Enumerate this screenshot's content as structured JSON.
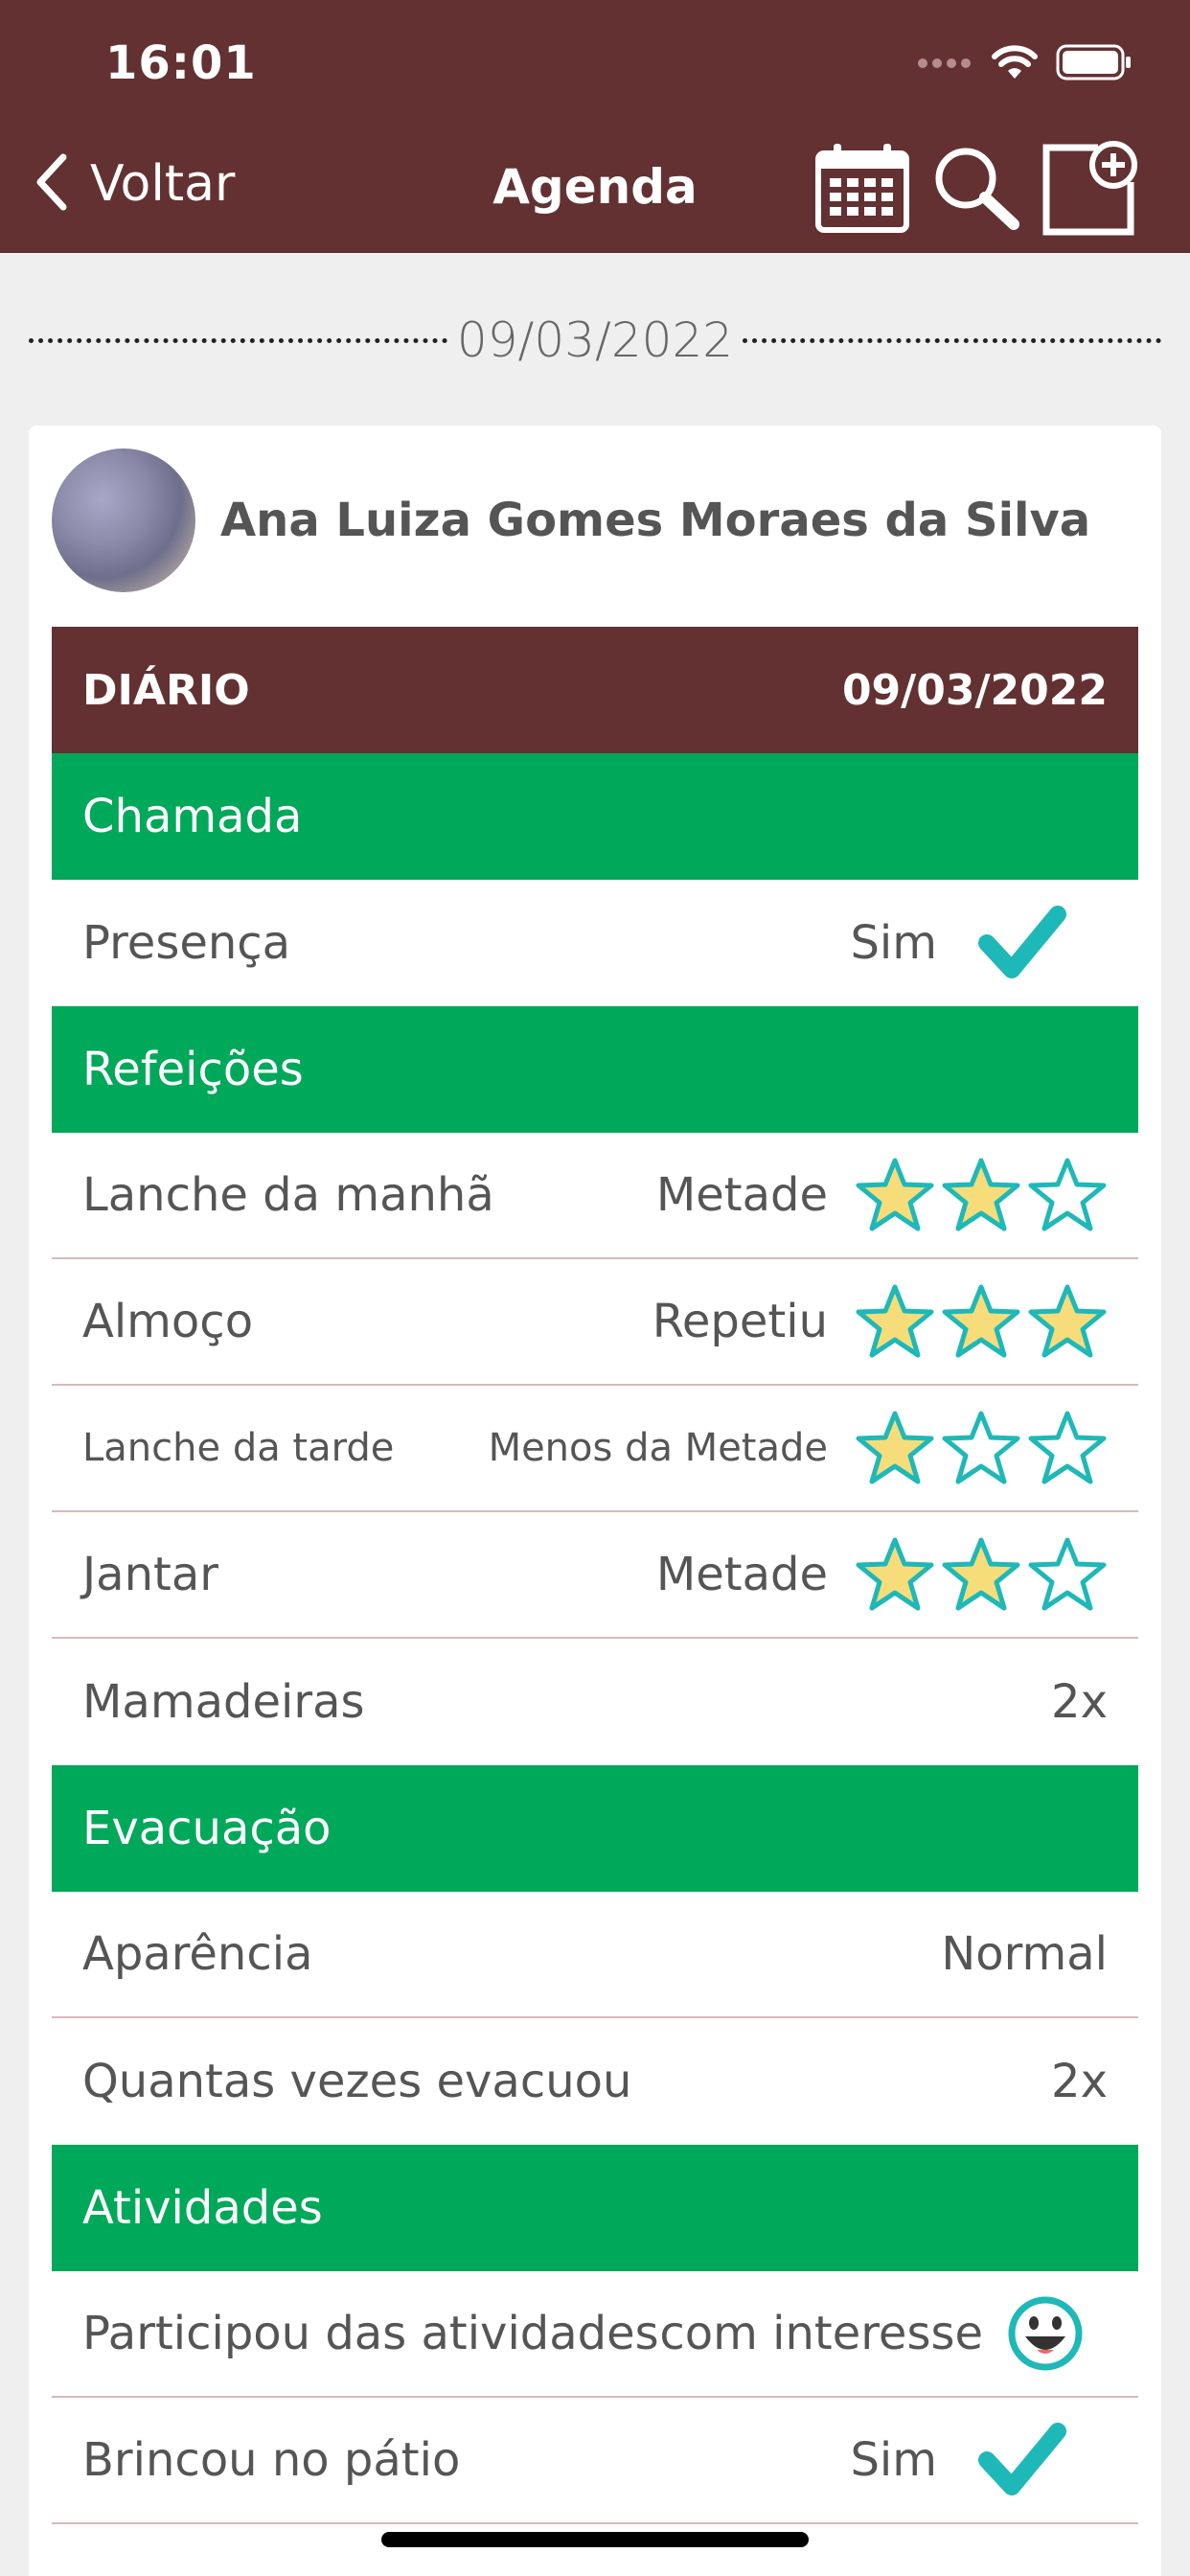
{
  "status_bar": {
    "time": "16:01"
  },
  "header": {
    "back_label": "Voltar",
    "title": "Agenda",
    "actions": [
      "calendar-icon",
      "search-icon",
      "new-note-icon"
    ]
  },
  "date_divider": "09/03/2022",
  "student": {
    "name": "Ana Luiza Gomes Moraes da Silva"
  },
  "diario": {
    "title": "DIÁRIO",
    "date": "09/03/2022"
  },
  "sections": {
    "chamada": {
      "title": "Chamada",
      "rows": [
        {
          "label": "Presença",
          "value": "Sim",
          "icon": "checkmark-icon"
        }
      ]
    },
    "refeicoes": {
      "title": "Refeições",
      "rows": [
        {
          "label": "Lanche da manhã",
          "value": "Metade",
          "rating": 2
        },
        {
          "label": "Almoço",
          "value": "Repetiu",
          "rating": 3
        },
        {
          "label": "Lanche da tarde",
          "value": "Menos da Metade",
          "rating": 1
        },
        {
          "label": "Jantar",
          "value": "Metade",
          "rating": 2
        },
        {
          "label": "Mamadeiras",
          "value": "2x"
        }
      ]
    },
    "evacuacao": {
      "title": "Evacuação",
      "rows": [
        {
          "label": "Aparência",
          "value": "Normal"
        },
        {
          "label": "Quantas vezes evacuou",
          "value": "2x"
        }
      ]
    },
    "atividades": {
      "title": "Atividades",
      "rows": [
        {
          "label": "Participou das atividades",
          "value": "com interesse",
          "icon": "happy-face-icon"
        },
        {
          "label": "Brincou no pátio",
          "value": "Sim",
          "icon": "checkmark-icon"
        }
      ]
    }
  },
  "rating_max": 3,
  "colors": {
    "brand": "#633132",
    "section": "#00a85a",
    "accent": "#1fb8b8",
    "star_fill": "#f7dd7a"
  }
}
